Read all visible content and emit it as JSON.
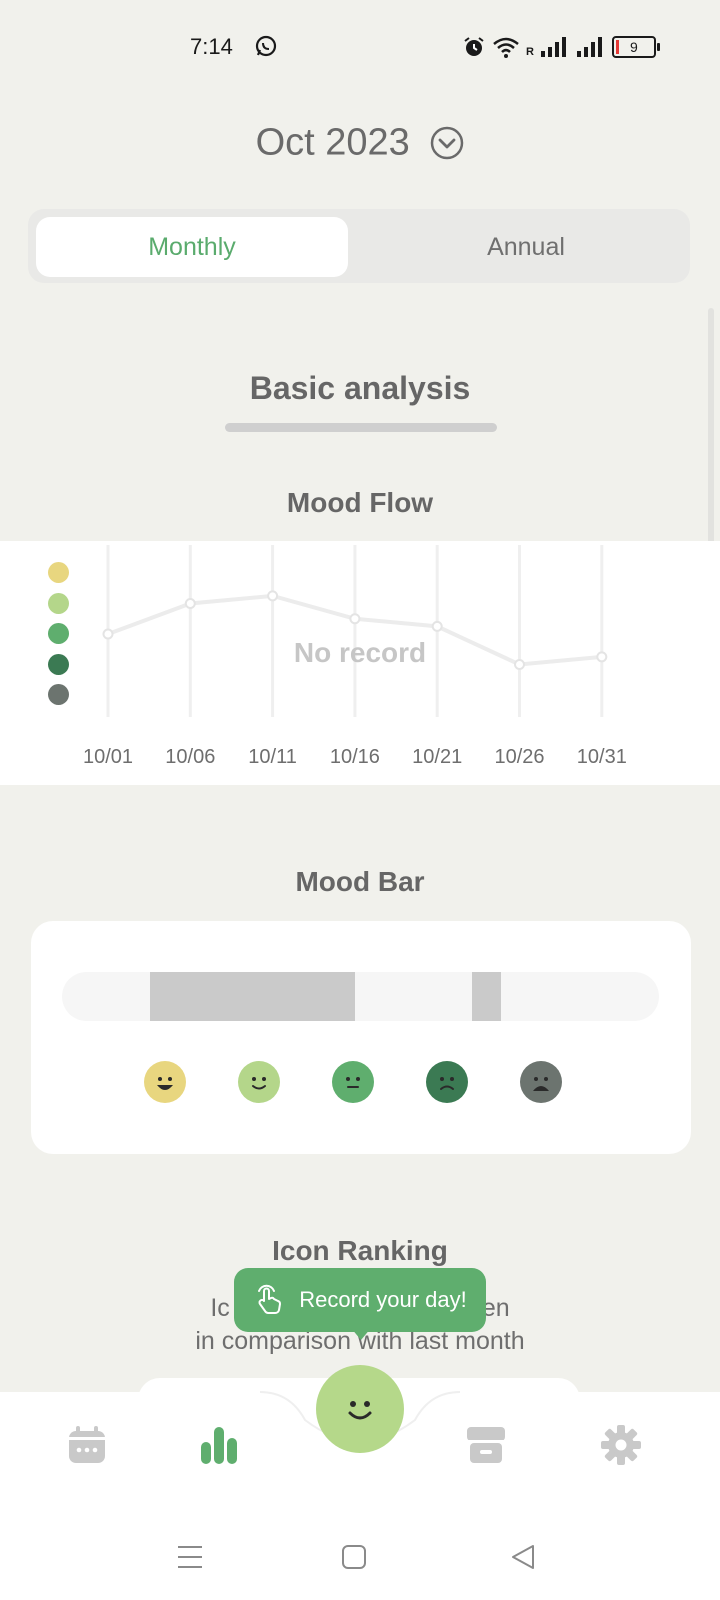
{
  "status_bar": {
    "time": "7:14",
    "battery": "9",
    "network_tag": "R",
    "icons": [
      "whatsapp-icon",
      "alarm-icon",
      "wifi-icon",
      "signal-icon",
      "signal-icon",
      "battery-icon"
    ]
  },
  "header": {
    "month": "Oct 2023",
    "dropdown_icon": "chevron-down-circle-icon"
  },
  "tabs": [
    {
      "label": "Monthly",
      "active": true
    },
    {
      "label": "Annual",
      "active": false
    }
  ],
  "section": {
    "title": "Basic analysis"
  },
  "mood_flow": {
    "title": "Mood Flow",
    "empty_text": "No record",
    "legend_colors": [
      "#e8d67f",
      "#b4d68a",
      "#5fae6e",
      "#3b7a53",
      "#6c746f"
    ],
    "chart_data": {
      "type": "line",
      "categories": [
        "10/01",
        "10/06",
        "10/11",
        "10/16",
        "10/21",
        "10/26",
        "10/31"
      ],
      "values": [
        3,
        4,
        4.25,
        3.5,
        3.25,
        2,
        2.25
      ],
      "ylim": [
        1,
        5
      ],
      "grid": true
    }
  },
  "mood_bar": {
    "title": "Mood Bar",
    "segments": [
      {
        "start": 0.148,
        "end": 0.49
      },
      {
        "start": 0.687,
        "end": 0.735
      }
    ],
    "faces": [
      {
        "name": "very-happy-face-icon",
        "color": "#e8d67f"
      },
      {
        "name": "happy-face-icon",
        "color": "#b4d68a"
      },
      {
        "name": "neutral-face-icon",
        "color": "#5fae6e"
      },
      {
        "name": "sad-face-icon",
        "color": "#3b7a53"
      },
      {
        "name": "very-sad-face-icon",
        "color": "#6c746f"
      }
    ]
  },
  "icon_ranking": {
    "title": "Icon Ranking",
    "subtitle_line1": "Ic",
    "subtitle_line1_end": "en",
    "subtitle_line2": "in comparison with last month"
  },
  "tooltip": {
    "text": "Record your day!"
  },
  "bottom_nav": {
    "items": [
      "calendar-icon",
      "stats-icon",
      "record-mood-button",
      "store-icon",
      "settings-icon"
    ],
    "active": "stats-icon",
    "accent": "#5fae6e"
  },
  "system_nav": [
    "menu-icon",
    "home-icon",
    "back-icon"
  ]
}
